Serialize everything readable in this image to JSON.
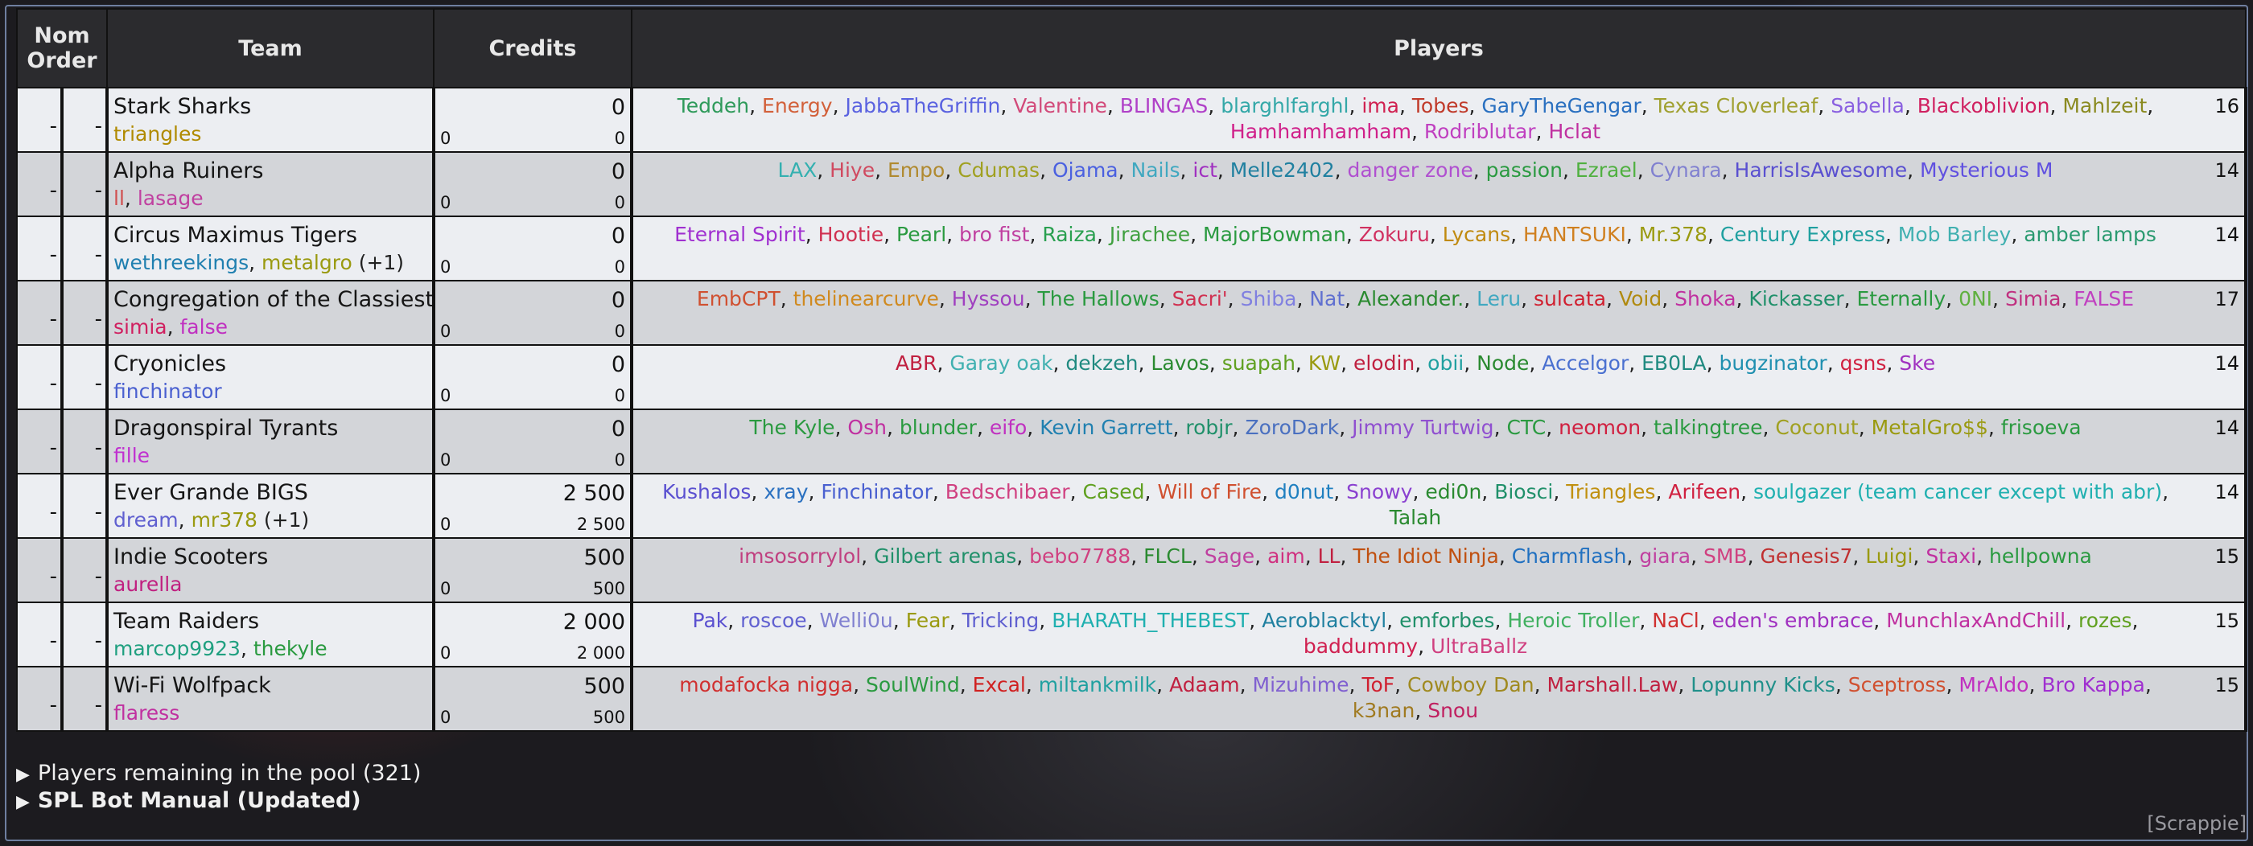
{
  "headers": {
    "order": "Nom Order",
    "team": "Team",
    "credits": "Credits",
    "players": "Players"
  },
  "teams": [
    {
      "name": "Stark Sharks",
      "coaches": [
        {
          "name": "triangles",
          "color": "#b08a00"
        }
      ],
      "extra": "",
      "credits": "0",
      "spent": "0",
      "remaining": "0",
      "count": "16",
      "players": [
        {
          "name": "Teddeh",
          "color": "#2e9a5a"
        },
        {
          "name": "Energy",
          "color": "#d2603a"
        },
        {
          "name": "JabbaTheGriffin",
          "color": "#5a62e0"
        },
        {
          "name": "Valentine",
          "color": "#d24a7a"
        },
        {
          "name": "BLINGAS",
          "color": "#b040c8"
        },
        {
          "name": "blarghlfarghl",
          "color": "#34a8a8"
        },
        {
          "name": "ima",
          "color": "#d02050"
        },
        {
          "name": "Tobes",
          "color": "#c03a2a"
        },
        {
          "name": "GaryTheGengar",
          "color": "#2a70c0"
        },
        {
          "name": "Texas Cloverleaf",
          "color": "#a0a030"
        },
        {
          "name": "Sabella",
          "color": "#8a60e0"
        },
        {
          "name": "Blackoblivion",
          "color": "#d02060"
        },
        {
          "name": "Mahlzeit",
          "color": "#8a8a20"
        },
        {
          "name": "Hamhamhamham",
          "color": "#d0208a"
        },
        {
          "name": "Rodriblutar",
          "color": "#c040c0"
        },
        {
          "name": "Hclat",
          "color": "#c030a0"
        }
      ]
    },
    {
      "name": "Alpha Ruiners",
      "coaches": [
        {
          "name": "ll",
          "color": "#d05050"
        },
        {
          "name": "lasage",
          "color": "#c040a0"
        }
      ],
      "extra": "",
      "credits": "0",
      "spent": "0",
      "remaining": "0",
      "count": "14",
      "players": [
        {
          "name": "LAX",
          "color": "#34b0b0"
        },
        {
          "name": "Hiye",
          "color": "#d04a60"
        },
        {
          "name": "Empo",
          "color": "#b08a30"
        },
        {
          "name": "Cdumas",
          "color": "#a0a020"
        },
        {
          "name": "Ojama",
          "color": "#4a60e0"
        },
        {
          "name": "Nails",
          "color": "#40a8c0"
        },
        {
          "name": "ict",
          "color": "#a030c0"
        },
        {
          "name": "Melle2402",
          "color": "#2080a0"
        },
        {
          "name": "danger zone",
          "color": "#b050d0"
        },
        {
          "name": "passion",
          "color": "#2a9a40"
        },
        {
          "name": "Ezrael",
          "color": "#50b040"
        },
        {
          "name": "Cynara",
          "color": "#8080d0"
        },
        {
          "name": "HarrisIsAwesome",
          "color": "#5a50d0"
        },
        {
          "name": "Mysterious M",
          "color": "#6050e0"
        }
      ]
    },
    {
      "name": "Circus Maximus Tigers",
      "coaches": [
        {
          "name": "wethreekings",
          "color": "#2080b0"
        },
        {
          "name": "metalgro",
          "color": "#9a9a10"
        }
      ],
      "extra": " (+1)",
      "credits": "0",
      "spent": "0",
      "remaining": "0",
      "count": "14",
      "players": [
        {
          "name": "Eternal Spirit",
          "color": "#a030d0"
        },
        {
          "name": "Hootie",
          "color": "#d03050"
        },
        {
          "name": "Pearl",
          "color": "#2a9a40"
        },
        {
          "name": "bro fist",
          "color": "#c040a0"
        },
        {
          "name": "Raiza",
          "color": "#2aa050"
        },
        {
          "name": "Jirachee",
          "color": "#40a040"
        },
        {
          "name": "MajorBowman",
          "color": "#2a9a40"
        },
        {
          "name": "Zokuru",
          "color": "#d03060"
        },
        {
          "name": "Lycans",
          "color": "#c08a10"
        },
        {
          "name": "HANTSUKI",
          "color": "#d08020"
        },
        {
          "name": "Mr.378",
          "color": "#9a9a10"
        },
        {
          "name": "Century Express",
          "color": "#20a0a0"
        },
        {
          "name": "Mob Barley",
          "color": "#40b0b0"
        },
        {
          "name": "amber lamps",
          "color": "#2a9a70"
        }
      ]
    },
    {
      "name": "Congregation of the Classiest",
      "coaches": [
        {
          "name": "simia",
          "color": "#d02060"
        },
        {
          "name": "false",
          "color": "#c030c0"
        }
      ],
      "extra": "",
      "credits": "0",
      "spent": "0",
      "remaining": "0",
      "count": "17",
      "players": [
        {
          "name": "EmbCPT",
          "color": "#d05030"
        },
        {
          "name": "thelinearcurve",
          "color": "#d08a20"
        },
        {
          "name": "Hyssou",
          "color": "#a040c0"
        },
        {
          "name": "The Hallows",
          "color": "#2a9a40"
        },
        {
          "name": "Sacri'",
          "color": "#d03050"
        },
        {
          "name": "Shiba",
          "color": "#8080e0"
        },
        {
          "name": "Nat",
          "color": "#6070d0"
        },
        {
          "name": "Alexander.",
          "color": "#2a8a30"
        },
        {
          "name": "Leru",
          "color": "#40a8c0"
        },
        {
          "name": "sulcata",
          "color": "#d02030"
        },
        {
          "name": "Void",
          "color": "#b08a10"
        },
        {
          "name": "Shoka",
          "color": "#c030a0"
        },
        {
          "name": "Kickasser",
          "color": "#20906a"
        },
        {
          "name": "Eternally",
          "color": "#2a9a40"
        },
        {
          "name": "0NI",
          "color": "#60b040"
        },
        {
          "name": "Simia",
          "color": "#c03080"
        },
        {
          "name": "FALSE",
          "color": "#c040c0"
        }
      ]
    },
    {
      "name": "Cryonicles",
      "coaches": [
        {
          "name": "finchinator",
          "color": "#4a60d0"
        }
      ],
      "extra": "",
      "credits": "0",
      "spent": "0",
      "remaining": "0",
      "count": "14",
      "players": [
        {
          "name": "ABR",
          "color": "#c02040"
        },
        {
          "name": "Garay oak",
          "color": "#40b0b0"
        },
        {
          "name": "dekzeh",
          "color": "#208a80"
        },
        {
          "name": "Lavos",
          "color": "#2a8a30"
        },
        {
          "name": "suapah",
          "color": "#60a020"
        },
        {
          "name": "KW",
          "color": "#9a9a10"
        },
        {
          "name": "elodin",
          "color": "#c02040"
        },
        {
          "name": "obii",
          "color": "#20a0a0"
        },
        {
          "name": "Node",
          "color": "#2a8a30"
        },
        {
          "name": "Accelgor",
          "color": "#4a70d0"
        },
        {
          "name": "EB0LA",
          "color": "#208a80"
        },
        {
          "name": "bugzinator",
          "color": "#2090b0"
        },
        {
          "name": "qsns",
          "color": "#d02040"
        },
        {
          "name": "Ske",
          "color": "#a030c0"
        }
      ]
    },
    {
      "name": "Dragonspiral Tyrants",
      "coaches": [
        {
          "name": "fille",
          "color": "#c030d0"
        }
      ],
      "extra": "",
      "credits": "0",
      "spent": "0",
      "remaining": "0",
      "count": "14",
      "players": [
        {
          "name": "The Kyle",
          "color": "#2a9a40"
        },
        {
          "name": "Osh",
          "color": "#c030a0"
        },
        {
          "name": "blunder",
          "color": "#2a9a40"
        },
        {
          "name": "eifo",
          "color": "#c030c0"
        },
        {
          "name": "Kevin Garrett",
          "color": "#2080b0"
        },
        {
          "name": "robjr",
          "color": "#20906a"
        },
        {
          "name": "ZoroDark",
          "color": "#4a70c0"
        },
        {
          "name": "Jimmy Turtwig",
          "color": "#9050d0"
        },
        {
          "name": "CTC",
          "color": "#2a9a40"
        },
        {
          "name": "neomon",
          "color": "#d02040"
        },
        {
          "name": "talkingtree",
          "color": "#2a9a40"
        },
        {
          "name": "Coconut",
          "color": "#a0a020"
        },
        {
          "name": "MetalGro$$",
          "color": "#9a9a10"
        },
        {
          "name": "frisoeva",
          "color": "#2a9a40"
        }
      ]
    },
    {
      "name": "Ever Grande BIGS",
      "coaches": [
        {
          "name": "dream",
          "color": "#6060d0"
        },
        {
          "name": "mr378",
          "color": "#9a9a10"
        }
      ],
      "extra": " (+1)",
      "credits": "2 500",
      "spent": "0",
      "remaining": "2 500",
      "count": "14",
      "players": [
        {
          "name": "Kushalos",
          "color": "#5a50d0"
        },
        {
          "name": "xray",
          "color": "#2a70c0"
        },
        {
          "name": "Finchinator",
          "color": "#4a60d0"
        },
        {
          "name": "Bedschibaer",
          "color": "#d04080"
        },
        {
          "name": "Cased",
          "color": "#60a020"
        },
        {
          "name": "Will of Fire",
          "color": "#d05030"
        },
        {
          "name": "d0nut",
          "color": "#2080c0"
        },
        {
          "name": "Snowy",
          "color": "#8a40d0"
        },
        {
          "name": "edi0n",
          "color": "#2a8a30"
        },
        {
          "name": "Biosci",
          "color": "#20906a"
        },
        {
          "name": "Triangles",
          "color": "#c09010"
        },
        {
          "name": "Arifeen",
          "color": "#d02040"
        },
        {
          "name": "soulgazer (team cancer except with abr)",
          "color": "#20b0b0"
        },
        {
          "name": "Talah",
          "color": "#2a8a30"
        }
      ]
    },
    {
      "name": "Indie Scooters",
      "coaches": [
        {
          "name": "aurella",
          "color": "#c02080"
        }
      ],
      "extra": "",
      "credits": "500",
      "spent": "0",
      "remaining": "500",
      "count": "15",
      "players": [
        {
          "name": "imsosorrylol",
          "color": "#c04080"
        },
        {
          "name": "Gilbert arenas",
          "color": "#20906a"
        },
        {
          "name": "bebo7788",
          "color": "#d04080"
        },
        {
          "name": "FLCL",
          "color": "#2a8a30"
        },
        {
          "name": "Sage",
          "color": "#c040a0"
        },
        {
          "name": "aim",
          "color": "#d03080"
        },
        {
          "name": "LL",
          "color": "#c02040"
        },
        {
          "name": "The Idiot Ninja",
          "color": "#c05010"
        },
        {
          "name": "Charmflash",
          "color": "#2070c0"
        },
        {
          "name": "giara",
          "color": "#c040a0"
        },
        {
          "name": "SMB",
          "color": "#d04080"
        },
        {
          "name": "Genesis7",
          "color": "#c03030"
        },
        {
          "name": "Luigi",
          "color": "#9a9a10"
        },
        {
          "name": "Staxi",
          "color": "#c030a0"
        },
        {
          "name": "hellpowna",
          "color": "#2a9a40"
        }
      ]
    },
    {
      "name": "Team Raiders",
      "coaches": [
        {
          "name": "marcop9923",
          "color": "#20a080"
        },
        {
          "name": "thekyle",
          "color": "#2a9a40"
        }
      ],
      "extra": "",
      "credits": "2 000",
      "spent": "0",
      "remaining": "2 000",
      "count": "15",
      "players": [
        {
          "name": "Pak",
          "color": "#5a50d0"
        },
        {
          "name": "roscoe",
          "color": "#6060d0"
        },
        {
          "name": "Welli0u",
          "color": "#8080d0"
        },
        {
          "name": "Fear",
          "color": "#9a9a10"
        },
        {
          "name": "Tricking",
          "color": "#6060d0"
        },
        {
          "name": "BHARATH_THEBEST",
          "color": "#20b0b0"
        },
        {
          "name": "Aeroblacktyl",
          "color": "#2080a0"
        },
        {
          "name": "emforbes",
          "color": "#20906a"
        },
        {
          "name": "Heroic Troller",
          "color": "#40b060"
        },
        {
          "name": "NaCl",
          "color": "#d03030"
        },
        {
          "name": "eden's embrace",
          "color": "#a030c0"
        },
        {
          "name": "MunchlaxAndChill",
          "color": "#c030a0"
        },
        {
          "name": "rozes",
          "color": "#60a020"
        },
        {
          "name": "baddummy",
          "color": "#d02050"
        },
        {
          "name": "UltraBallz",
          "color": "#d04080"
        }
      ]
    },
    {
      "name": "Wi-Fi Wolfpack",
      "coaches": [
        {
          "name": "flaress",
          "color": "#c030a0"
        }
      ],
      "extra": "",
      "credits": "500",
      "spent": "0",
      "remaining": "500",
      "count": "15",
      "players": [
        {
          "name": "modafocka nigga",
          "color": "#d03030"
        },
        {
          "name": "SoulWind",
          "color": "#2a9a40"
        },
        {
          "name": "Excal",
          "color": "#d02020"
        },
        {
          "name": "miltankmilk",
          "color": "#20a0a0"
        },
        {
          "name": "Adaam",
          "color": "#c02040"
        },
        {
          "name": "Mizuhime",
          "color": "#8060d0"
        },
        {
          "name": "ToF",
          "color": "#d02030"
        },
        {
          "name": "Cowboy Dan",
          "color": "#a08a20"
        },
        {
          "name": "Marshall.Law",
          "color": "#c02040"
        },
        {
          "name": "Lopunny Kicks",
          "color": "#20908a"
        },
        {
          "name": "Sceptross",
          "color": "#d05030"
        },
        {
          "name": "MrAldo",
          "color": "#c030c0"
        },
        {
          "name": "Bro Kappa",
          "color": "#a030d0"
        },
        {
          "name": "k3nan",
          "color": "#a07a20"
        },
        {
          "name": "Snou",
          "color": "#c02060"
        }
      ]
    }
  ],
  "dash": "-",
  "pool_label": "Players remaining in the pool (321)",
  "manual_label": "SPL Bot Manual (Updated)",
  "credit_tag": "[Scrappie]"
}
